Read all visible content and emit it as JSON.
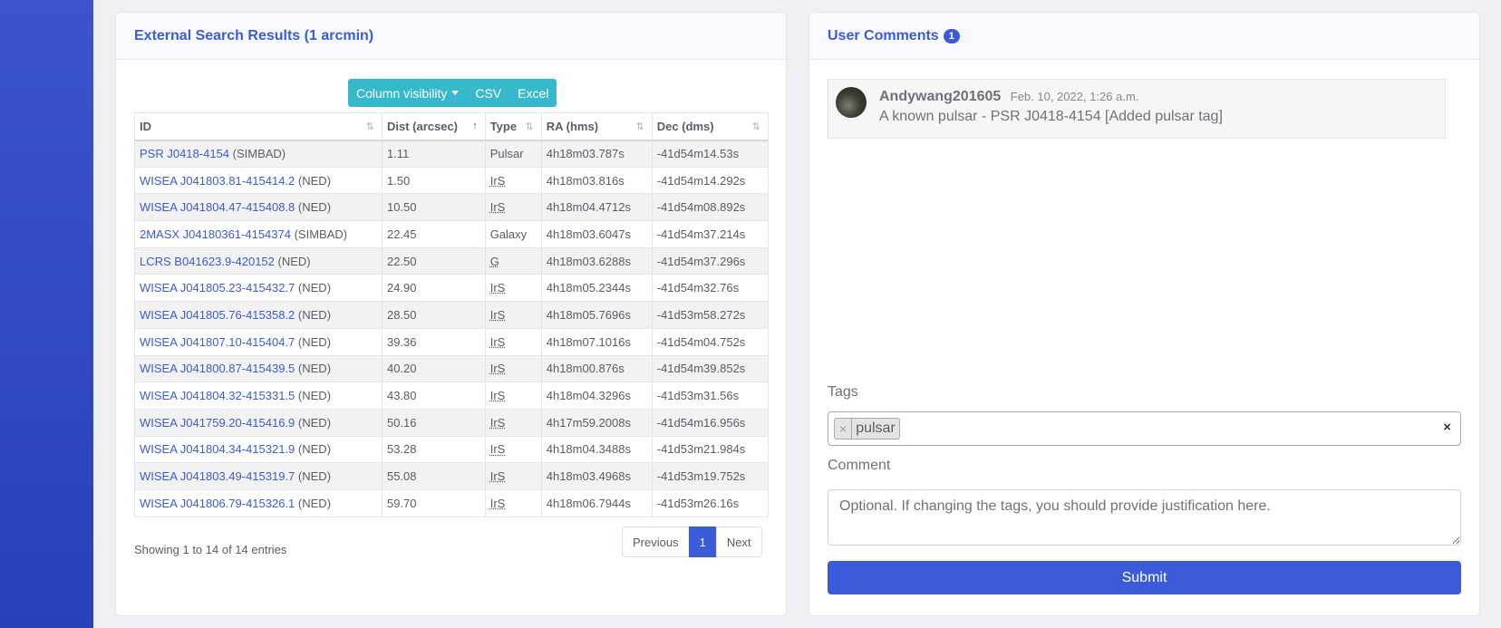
{
  "search_results": {
    "title": "External Search Results (1 arcmin)",
    "toolbar": {
      "column_visibility": "Column visibility",
      "csv": "CSV",
      "excel": "Excel"
    },
    "columns": [
      "ID",
      "Dist (arcsec)",
      "Type",
      "RA (hms)",
      "Dec (dms)"
    ],
    "rows": [
      {
        "id": "PSR J0418-4154",
        "source": "(SIMBAD)",
        "dist": "1.11",
        "type": "Pulsar",
        "ra": "4h18m03.787s",
        "dec": "-41d54m14.53s"
      },
      {
        "id": "WISEA J041803.81-415414.2",
        "source": "(NED)",
        "dist": "1.50",
        "type": "IrS",
        "ra": "4h18m03.816s",
        "dec": "-41d54m14.292s"
      },
      {
        "id": "WISEA J041804.47-415408.8",
        "source": "(NED)",
        "dist": "10.50",
        "type": "IrS",
        "ra": "4h18m04.4712s",
        "dec": "-41d54m08.892s"
      },
      {
        "id": "2MASX J04180361-4154374",
        "source": "(SIMBAD)",
        "dist": "22.45",
        "type": "Galaxy",
        "ra": "4h18m03.6047s",
        "dec": "-41d54m37.214s"
      },
      {
        "id": "LCRS B041623.9-420152",
        "source": "(NED)",
        "dist": "22.50",
        "type": "G",
        "ra": "4h18m03.6288s",
        "dec": "-41d54m37.296s"
      },
      {
        "id": "WISEA J041805.23-415432.7",
        "source": "(NED)",
        "dist": "24.90",
        "type": "IrS",
        "ra": "4h18m05.2344s",
        "dec": "-41d54m32.76s"
      },
      {
        "id": "WISEA J041805.76-415358.2",
        "source": "(NED)",
        "dist": "28.50",
        "type": "IrS",
        "ra": "4h18m05.7696s",
        "dec": "-41d53m58.272s"
      },
      {
        "id": "WISEA J041807.10-415404.7",
        "source": "(NED)",
        "dist": "39.36",
        "type": "IrS",
        "ra": "4h18m07.1016s",
        "dec": "-41d54m04.752s"
      },
      {
        "id": "WISEA J041800.87-415439.5",
        "source": "(NED)",
        "dist": "40.20",
        "type": "IrS",
        "ra": "4h18m00.876s",
        "dec": "-41d54m39.852s"
      },
      {
        "id": "WISEA J041804.32-415331.5",
        "source": "(NED)",
        "dist": "43.80",
        "type": "IrS",
        "ra": "4h18m04.3296s",
        "dec": "-41d53m31.56s"
      },
      {
        "id": "WISEA J041759.20-415416.9",
        "source": "(NED)",
        "dist": "50.16",
        "type": "IrS",
        "ra": "4h17m59.2008s",
        "dec": "-41d54m16.956s"
      },
      {
        "id": "WISEA J041804.34-415321.9",
        "source": "(NED)",
        "dist": "53.28",
        "type": "IrS",
        "ra": "4h18m04.3488s",
        "dec": "-41d53m21.984s"
      },
      {
        "id": "WISEA J041803.49-415319.7",
        "source": "(NED)",
        "dist": "55.08",
        "type": "IrS",
        "ra": "4h18m03.4968s",
        "dec": "-41d53m19.752s"
      },
      {
        "id": "WISEA J041806.79-415326.1",
        "source": "(NED)",
        "dist": "59.70",
        "type": "IrS",
        "ra": "4h18m06.7944s",
        "dec": "-41d53m26.16s"
      }
    ],
    "info": "Showing 1 to 14 of 14 entries",
    "pagination": {
      "previous": "Previous",
      "current": "1",
      "next": "Next"
    }
  },
  "comments": {
    "title": "User Comments",
    "count": "1",
    "items": [
      {
        "author": "Andywang201605",
        "date": "Feb. 10, 2022, 1:26 a.m.",
        "text": "A known pulsar - PSR J0418-4154 [Added pulsar tag]"
      }
    ],
    "tags_label": "Tags",
    "tags": [
      "pulsar"
    ],
    "tag_remove": "×",
    "clear": "×",
    "comment_label": "Comment",
    "comment_placeholder": "Optional. If changing the tags, you should provide justification here.",
    "submit": "Submit"
  },
  "colors": {
    "accent": "#3b5bdb",
    "toolbar": "#36b9cc",
    "sidebar": "#2f4ac0"
  }
}
